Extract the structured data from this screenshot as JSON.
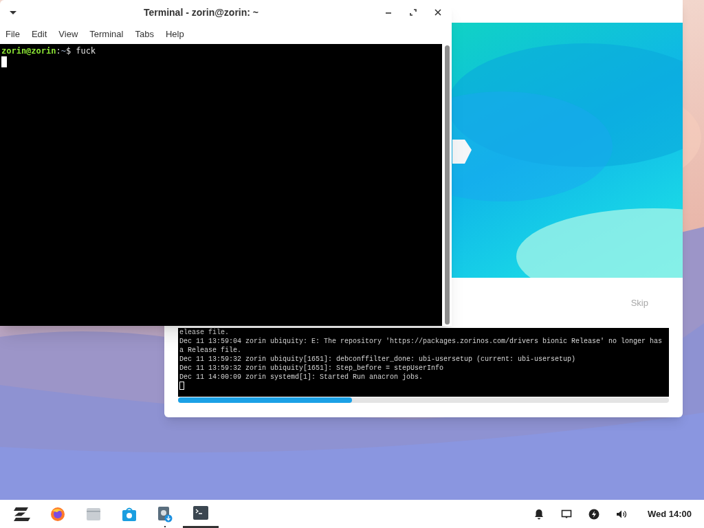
{
  "terminal": {
    "title": "Terminal - zorin@zorin: ~",
    "menu": [
      "File",
      "Edit",
      "View",
      "Terminal",
      "Tabs",
      "Help"
    ],
    "prompt_user": "zorin@zorin",
    "prompt_sep": ":",
    "prompt_path": "~",
    "prompt_symbol": "$",
    "command": "fuck"
  },
  "installer": {
    "log_lines": [
      "elease file.",
      "Dec 11 13:59:04 zorin ubiquity: E: The repository 'https://packages.zorinos.com/drivers bionic Release' no longer has a Release file.",
      "Dec 11 13:59:32 zorin ubiquity[1651]: debconffilter_done: ubi-usersetup (current: ubi-usersetup)",
      "Dec 11 13:59:32 zorin ubiquity[1651]: Step_before = stepUserInfo",
      "Dec 11 14:00:09 zorin systemd[1]: Started Run anacron jobs."
    ],
    "skip": "Skip",
    "progress": {
      "level": 0.355
    }
  },
  "taskbar": {
    "apps": [
      {
        "kind": "zorin",
        "active": false,
        "running": false
      },
      {
        "kind": "firefox",
        "active": false,
        "running": false
      },
      {
        "kind": "files",
        "active": false,
        "running": false
      },
      {
        "kind": "store",
        "active": false,
        "running": false
      },
      {
        "kind": "updater",
        "active": false,
        "running": true
      },
      {
        "kind": "terminal",
        "active": true,
        "running": true
      }
    ],
    "tray": [
      {
        "kind": "bell"
      },
      {
        "kind": "screen"
      },
      {
        "kind": "power"
      },
      {
        "kind": "volume"
      }
    ],
    "clock": "Wed 14:00"
  }
}
